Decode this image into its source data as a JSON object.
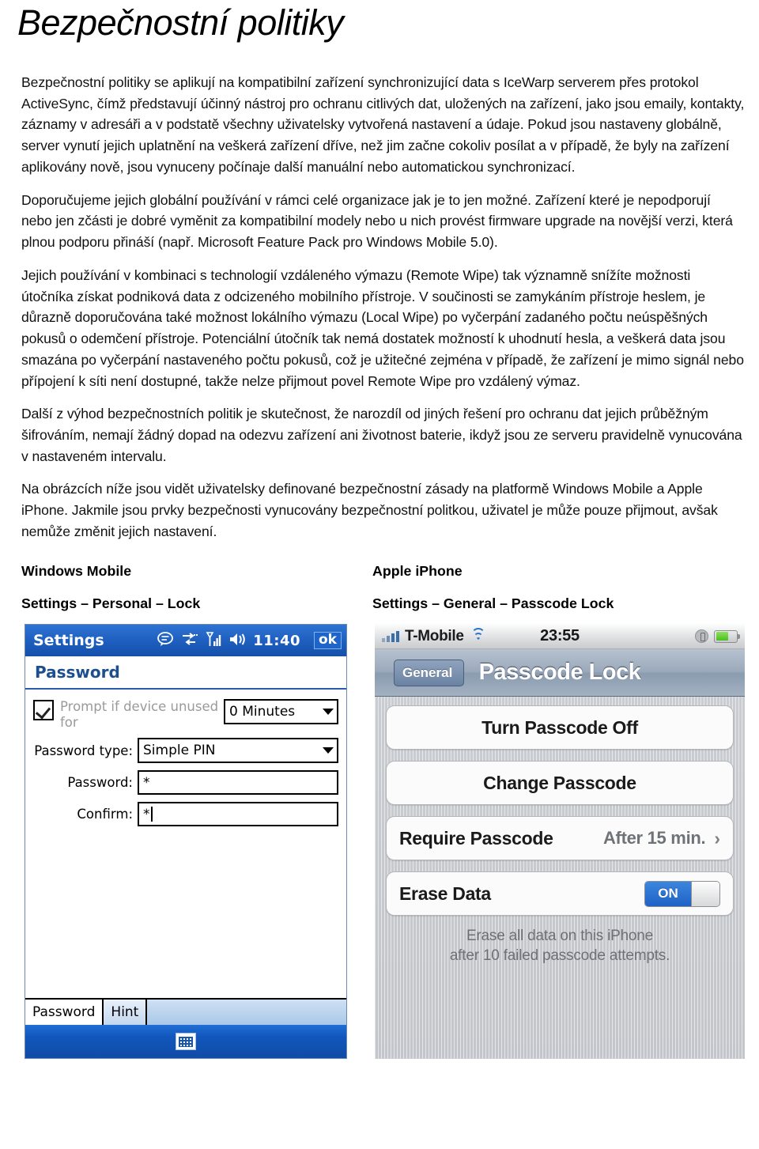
{
  "document": {
    "title": "Bezpečnostní politiky",
    "paragraphs": [
      "Bezpečnostní politiky se aplikují na kompatibilní zařízení synchronizující data s IceWarp serverem přes protokol ActiveSync, čímž představují účinný nástroj pro ochranu citlivých dat, uložených na zařízení, jako jsou emaily, kontakty, záznamy v adresáři a v podstatě všechny uživatelsky vytvořená nastavení a údaje. Pokud jsou nastaveny globálně, server vynutí jejich uplatnění na veškerá zařízení dříve, než jim začne cokoliv posílat a v případě, že byly na zařízení aplikovány nově, jsou vynuceny počínaje další manuální nebo automatickou synchronizací.",
      "Doporučujeme jejich globální používání v rámci celé organizace jak je to jen možné. Zařízení které je nepodporují nebo jen zčásti je dobré vyměnit za kompatibilní modely nebo u nich provést firmware upgrade na novější verzi, která plnou podporu přináší (např. Microsoft Feature Pack pro Windows Mobile 5.0).",
      "Jejich používání v kombinaci s technologií vzdáleného výmazu (Remote Wipe) tak významně snížíte možnosti útočníka získat podniková data z odcizeného mobilního přístroje. V součinosti se zamykáním přístroje heslem, je důrazně doporučována také možnost lokálního výmazu (Local Wipe) po vyčerpání zadaného počtu neúspěšných pokusů o odemčení přístroje. Potenciální útočník tak nemá dostatek možností k uhodnutí hesla, a veškerá data jsou smazána po vyčerpání nastaveného počtu pokusů, což je užitečné zejména v případě, že zařízení je mimo signál nebo přípojení k síti není dostupné, takže nelze přijmout povel Remote Wipe pro vzdálený výmaz.",
      "Další z výhod bezpečnostních politik je skutečnost, že narozdíl od jiných řešení pro ochranu dat jejich průběžným šifrováním, nemají žádný dopad na odezvu zařízení ani životnost baterie, ikdyž jsou ze serveru pravidelně vynucována v nastaveném intervalu.",
      "Na obrázcích níže jsou vidět uživatelsky definované bezpečnostní zásady na platformě Windows Mobile a Apple iPhone. Jakmile jsou prvky bezpečnosti vynucovány bezpečnostní politkou, uživatel je může pouze přijmout, avšak nemůže změnit jejich nastavení."
    ]
  },
  "captions": {
    "left_title": "Windows Mobile",
    "left_path": "Settings – Personal – Lock",
    "right_title": "Apple iPhone",
    "right_path": "Settings – General – Passcode Lock"
  },
  "windows_mobile": {
    "titlebar": {
      "title": "Settings",
      "clock": "11:40",
      "ok_label": "ok",
      "icons": [
        "message-icon",
        "connectivity-icon",
        "signal-icon",
        "volume-icon"
      ]
    },
    "page_header": "Password",
    "prompt_checkbox_label": "Prompt if device unused for",
    "prompt_checkbox_checked": true,
    "timeout_value": "0 Minutes",
    "password_type_label": "Password type:",
    "password_type_value": "Simple PIN",
    "password_label": "Password:",
    "password_value": "*",
    "confirm_label": "Confirm:",
    "confirm_value": "*",
    "tabs": [
      {
        "label": "Password",
        "active": true
      },
      {
        "label": "Hint",
        "active": false
      }
    ],
    "softkey_icon": "keyboard-icon",
    "colors": {
      "titlebar": "#1e5fc0",
      "header_text": "#1d4f8f",
      "softbar": "#1257bd"
    }
  },
  "iphone": {
    "status": {
      "carrier": "T-Mobile",
      "time": "23:55",
      "signal_icon": "signal-bars-icon",
      "wifi_icon": "wifi-icon",
      "lock_icon": "rotation-lock-icon",
      "battery_icon": "battery-icon"
    },
    "nav": {
      "back_label": "General",
      "title": "Passcode Lock"
    },
    "rows": [
      {
        "type": "button",
        "label": "Turn Passcode Off"
      },
      {
        "type": "button",
        "label": "Change Passcode"
      },
      {
        "type": "value",
        "label": "Require Passcode",
        "value": "After 15 min.",
        "chevron": "›"
      },
      {
        "type": "toggle",
        "label": "Erase Data",
        "state": "ON"
      }
    ],
    "footnote": "Erase all data on this iPhone\nafter 10 failed passcode attempts.",
    "footnote_line1": "Erase all data on this iPhone",
    "footnote_line2": "after 10 failed passcode attempts.",
    "colors": {
      "toggle_on": "#1f62c4",
      "nav_bar": "#8b9cb0",
      "content_bg": "#c6c9ce"
    }
  }
}
